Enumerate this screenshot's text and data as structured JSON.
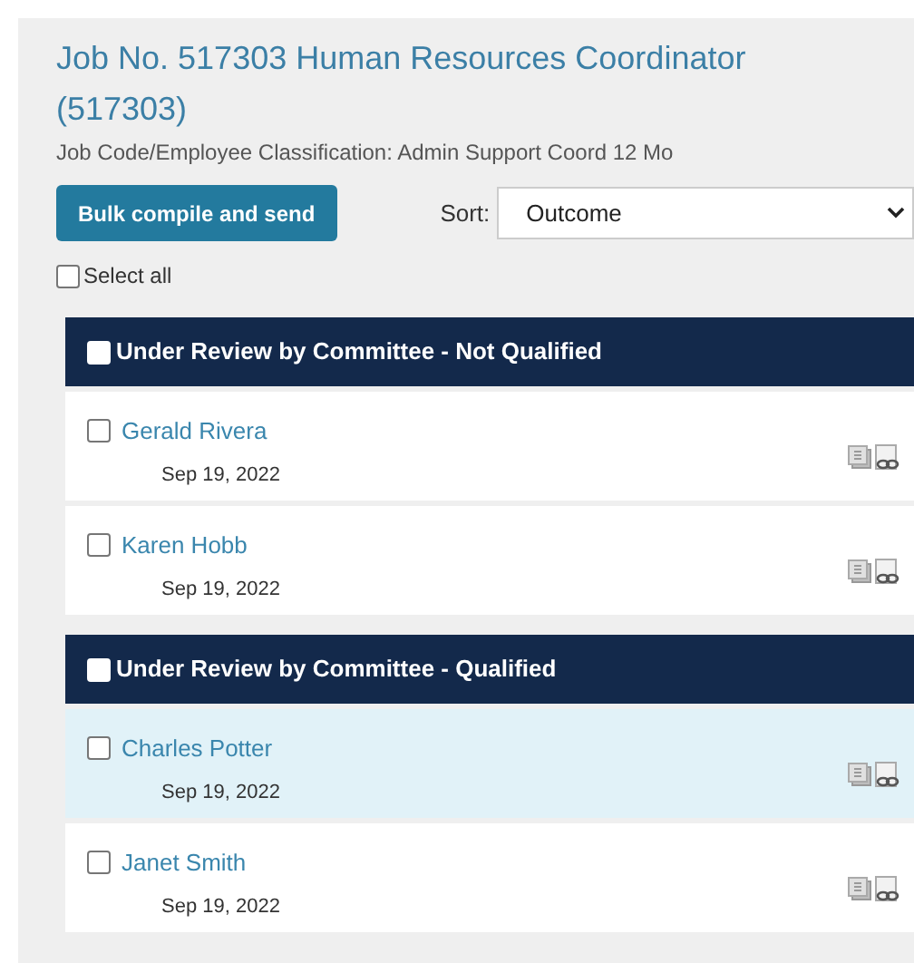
{
  "title": "Job No. 517303 Human Resources Coordinator (517303)",
  "subtitle": "Job Code/Employee Classification: Admin Support Coord 12 Mo",
  "bulk_button": "Bulk compile and send",
  "sort": {
    "label": "Sort:",
    "value": "Outcome"
  },
  "select_all": {
    "label": "Select all",
    "checked": false
  },
  "groups": [
    {
      "title": "Under Review by Committee - Not Qualified",
      "checked": false,
      "applicants": [
        {
          "name": "Gerald Rivera",
          "date": "Sep 19, 2022",
          "checked": false,
          "selected": false
        },
        {
          "name": "Karen Hobb",
          "date": "Sep 19, 2022",
          "checked": false,
          "selected": false
        }
      ]
    },
    {
      "title": "Under Review by Committee - Qualified",
      "checked": false,
      "applicants": [
        {
          "name": "Charles Potter",
          "date": "Sep 19, 2022",
          "checked": false,
          "selected": true
        },
        {
          "name": "Janet Smith",
          "date": "Sep 19, 2022",
          "checked": false,
          "selected": false
        }
      ]
    }
  ]
}
